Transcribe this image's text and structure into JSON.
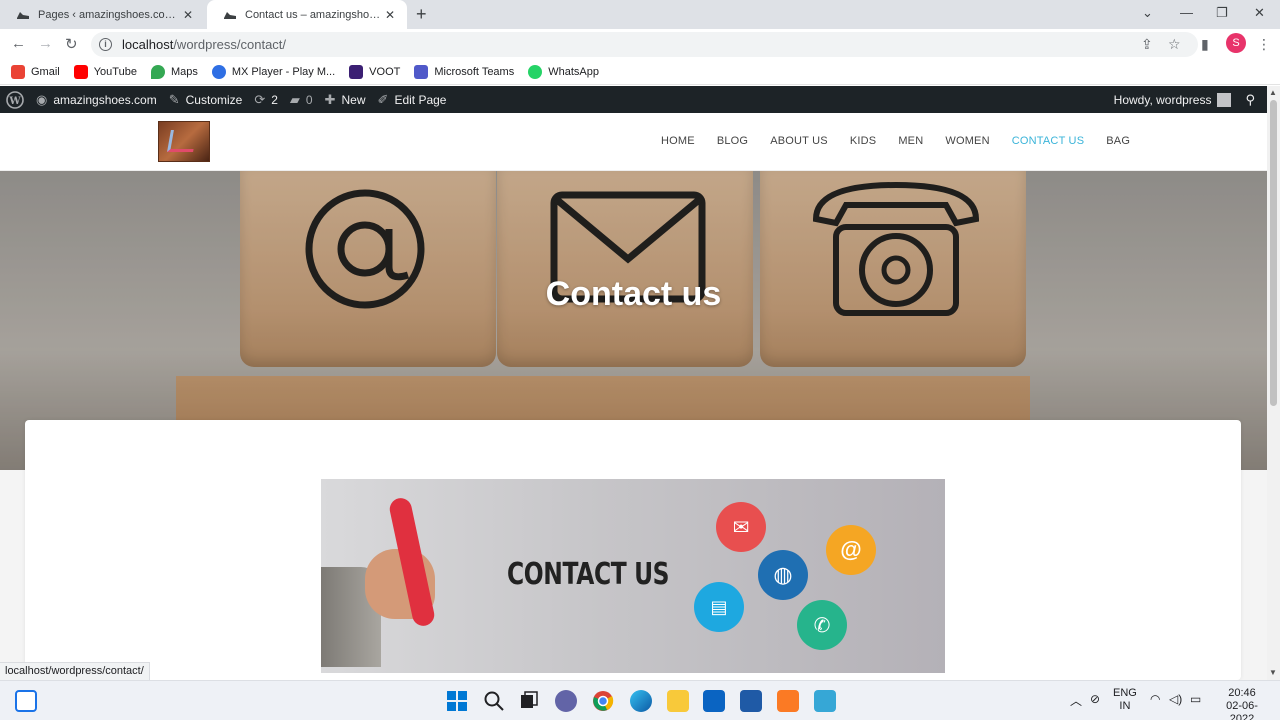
{
  "browser": {
    "tabs": [
      {
        "title": "Pages ‹ amazingshoes.com — W",
        "active": false
      },
      {
        "title": "Contact us – amazingshoes.com",
        "active": true
      }
    ],
    "url_host": "localhost",
    "url_path": "/wordpress/contact/",
    "profile_initial": "S",
    "bookmarks": [
      {
        "label": "Gmail",
        "color": "#ea4335"
      },
      {
        "label": "YouTube",
        "color": "#ff0000"
      },
      {
        "label": "Maps",
        "color": "#34a853"
      },
      {
        "label": "MX Player - Play M...",
        "color": "#2f6fe4"
      },
      {
        "label": "VOOT",
        "color": "#3b1f73"
      },
      {
        "label": "Microsoft Teams",
        "color": "#5059c9"
      },
      {
        "label": "WhatsApp",
        "color": "#25d366"
      }
    ]
  },
  "adminbar": {
    "site_name": "amazingshoes.com",
    "customize": "Customize",
    "updates_count": "2",
    "comments_count": "0",
    "new_label": "New",
    "edit_page": "Edit Page",
    "howdy": "Howdy, wordpress"
  },
  "site": {
    "nav": [
      {
        "label": "HOME",
        "current": false
      },
      {
        "label": "BLOG",
        "current": false
      },
      {
        "label": "ABOUT US",
        "current": false
      },
      {
        "label": "KIDS",
        "current": false
      },
      {
        "label": "MEN",
        "current": false
      },
      {
        "label": "WOMEN",
        "current": false
      },
      {
        "label": "CONTACT US",
        "current": true
      },
      {
        "label": "BAG",
        "current": false
      }
    ],
    "hero_title": "Contact us",
    "banner_text": "CONTACT US",
    "accent": "#3bb4d9"
  },
  "status_url": "localhost/wordpress/contact/",
  "tray": {
    "lang1": "ENG",
    "lang2": "IN",
    "time": "20:46",
    "date": "02-06-2022"
  }
}
